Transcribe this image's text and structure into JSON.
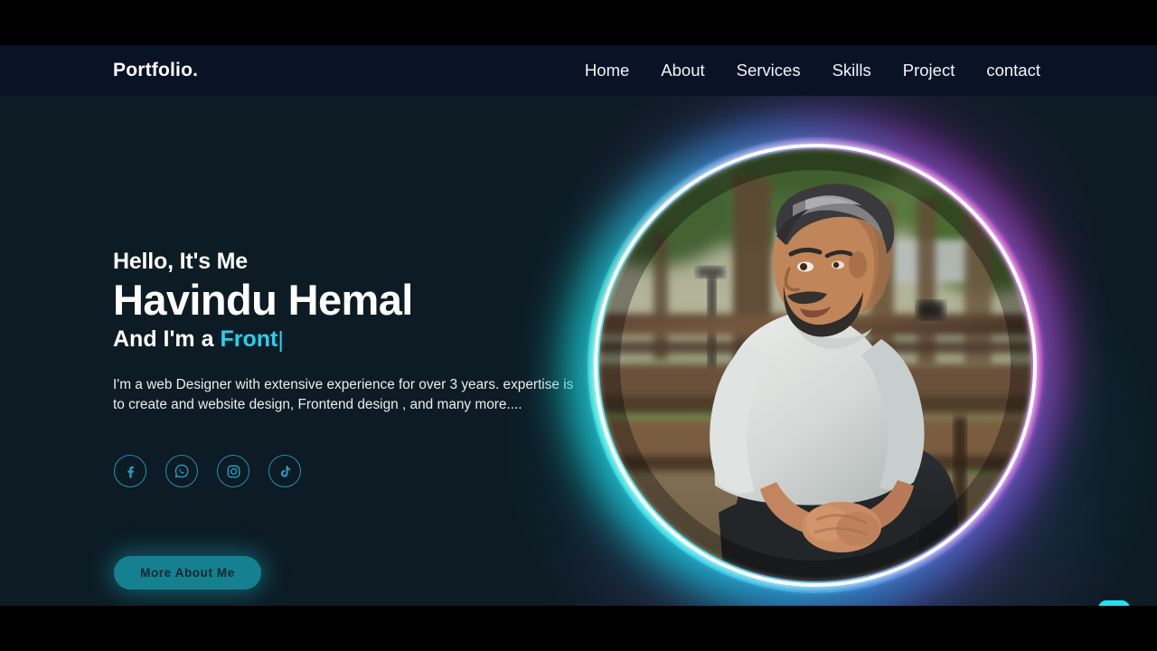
{
  "site": {
    "brand": "Portfolio.",
    "nav_items": [
      {
        "label": "Home",
        "name": "nav-link-home"
      },
      {
        "label": "About",
        "name": "nav-link-about"
      },
      {
        "label": "Services",
        "name": "nav-link-services"
      },
      {
        "label": "Skills",
        "name": "nav-link-skills"
      },
      {
        "label": "Project",
        "name": "nav-link-project"
      },
      {
        "label": "contact",
        "name": "nav-link-contact"
      }
    ]
  },
  "hero": {
    "greeting": "Hello, It's Me",
    "name": "Havindu Hemal",
    "role_prefix": "And I'm a ",
    "role_typed": "Front",
    "type_cursor": "|",
    "bio": "I'm a web Designer with extensive experience for over 3 years. expertise is to create and website design, Frontend design , and many more....",
    "cta_label": "More About Me",
    "photo_alt": "profile-photo-man-sitting-on-park-bench"
  },
  "socials": [
    {
      "name": "facebook-icon",
      "label": "Facebook"
    },
    {
      "name": "whatsapp-icon",
      "label": "WhatsApp"
    },
    {
      "name": "instagram-icon",
      "label": "Instagram"
    },
    {
      "name": "tiktok-icon",
      "label": "TikTok"
    }
  ],
  "scroll_top": {
    "name": "arrow-up-icon",
    "label": "Back to top"
  },
  "colors": {
    "page_background": "#0d1b24",
    "navbar_background": "#0a1226",
    "accent_cyan": "#22d3ee",
    "scroll_top_background": "#1ee4f5",
    "cta_background": "#15808f",
    "cta_text": "#0d2730",
    "social_border": "#1a93b0",
    "ring_purple": "#a52fb4",
    "ring_cyan": "#11dcd6",
    "text_primary": "#ffffff",
    "letterbox": "#000000"
  }
}
